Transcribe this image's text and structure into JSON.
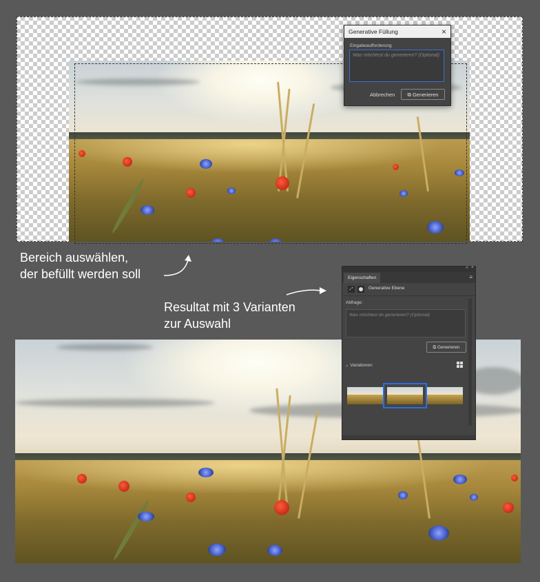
{
  "annotations": {
    "select_line1": "Bereich auswählen,",
    "select_line2": "der befüllt werden soll",
    "result_line1": "Resultat mit 3 Varianten",
    "result_line2": "zur Auswahl"
  },
  "gen_dialog": {
    "title": "Generative Füllung",
    "close_icon": "×",
    "prompt_label": "Eingabeaufforderung",
    "prompt_placeholder": "Was möchtest du generieren? (Optional)",
    "cancel_label": "Abbrechen",
    "generate_label": "Generieren"
  },
  "properties_panel": {
    "collapse_icon": "«",
    "close_icon": "×",
    "tab_label": "Eigenschaften",
    "menu_icon": "≡",
    "layer_type_label": "Generative Ebene",
    "query_label": "Abfrage:",
    "query_placeholder": "Was möchtest du generieren? (Optional)",
    "generate_label": "Generieren",
    "variations_label": "Variationen",
    "variations_count": 3,
    "selected_variation": 2
  },
  "colors": {
    "background": "#595959",
    "panel": "#444444",
    "accent_blue": "#2d6ee6"
  }
}
